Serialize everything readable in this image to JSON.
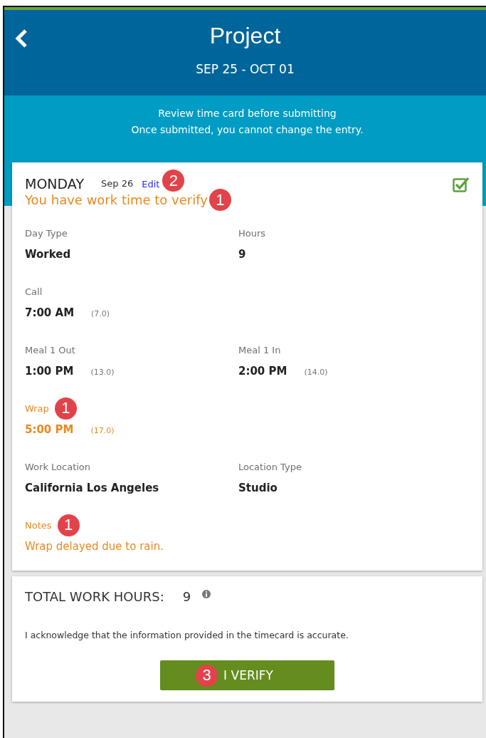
{
  "header": {
    "title": "Project",
    "date_range": "SEP 25 - OCT 01"
  },
  "banner": {
    "lines": [
      "Review time card before submitting",
      "Once submitted, you cannot change the entry."
    ]
  },
  "day_card": {
    "day": "MONDAY",
    "date": "Sep 26",
    "edit_link": "Edit",
    "edit_badge": "2",
    "checked": true,
    "warning": "You have work time to verify",
    "warning_badge": "1",
    "rows": [
      [
        {
          "label": "Day Type",
          "value": "Worked",
          "flagged": false
        },
        {
          "label": "Hours",
          "value": "9",
          "flagged": false
        }
      ],
      [
        {
          "label": "Call",
          "value": "7:00 AM",
          "hours": "(7.0)",
          "flagged": false
        }
      ],
      [
        {
          "label": "Meal 1 Out",
          "value": "1:00 PM",
          "hours": "(13.0)",
          "flagged": false
        },
        {
          "label": "Meal 1 In",
          "value": "2:00 PM",
          "hours": "(14.0)",
          "flagged": false
        }
      ],
      [
        {
          "label": "Wrap",
          "value": "5:00 PM",
          "hours": "(17.0)",
          "flagged": true,
          "badge": "1"
        }
      ],
      [
        {
          "label": "Work Location",
          "value": "California Los Angeles",
          "flagged": false
        },
        {
          "label": "Location Type",
          "value": "Studio",
          "flagged": false
        }
      ],
      [
        {
          "label": "Notes",
          "value": "Wrap delayed due to rain.",
          "flagged": true,
          "badge": "1"
        }
      ]
    ]
  },
  "total_card": {
    "label": "TOTAL WORK HOURS:",
    "value": "9",
    "acknowledgement": "I acknowledge that the information provided in the timecard is accurate.",
    "button": "I VERIFY",
    "button_badge": "3"
  }
}
